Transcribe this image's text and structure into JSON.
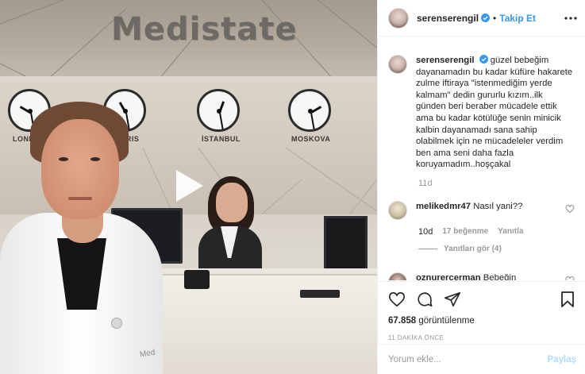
{
  "video": {
    "brand_sign": "Medistate",
    "clock_cities": [
      "LONDON",
      "PARIS",
      "İSTANBUL",
      "MOSKOVA"
    ],
    "coat_label": "Med"
  },
  "header": {
    "username": "serenserengil",
    "separator": "•",
    "follow_label": "Takip Et"
  },
  "caption": {
    "username": "serenserengil",
    "text": "güzel bebeğim dayanamadın bu kadar küfüre hakarete zulme iftiraya \"istenmediğim yerde kalmam\" dedin gururlu kızım..ilk günden beri beraber mücadele ettik ama bu kadar kötülüğe senin minicik kalbin dayanamadı sana sahip olabilmek için ne mücadeleler verdim ben ama seni daha fazla koruyamadım..hoşçakal",
    "time": "11d"
  },
  "comments": [
    {
      "username": "melikedmr47",
      "text": "Nasıl yani??",
      "time": "10d",
      "likes": "17 beğenme",
      "reply_label": "Yanıtla",
      "view_replies": "Yanıtları gör (4)"
    },
    {
      "username": "oznurercerman",
      "text": "Bebeğin cinsiyetinin kız olduğunu nasıl bilmiyoruz ?"
    }
  ],
  "stats": {
    "views_count": "67.858",
    "views_label": "görüntülenme",
    "timestamp": "11 DAKİKA ÖNCE"
  },
  "add_comment": {
    "placeholder": "Yorum ekle...",
    "post_label": "Paylaş"
  },
  "colors": {
    "link_blue": "#3897f0",
    "post_disabled": "#b3dbff",
    "muted": "#999999"
  },
  "icons": [
    "play-icon",
    "verified-icon",
    "more-icon",
    "heart-icon",
    "comment-icon",
    "share-icon",
    "bookmark-icon"
  ]
}
